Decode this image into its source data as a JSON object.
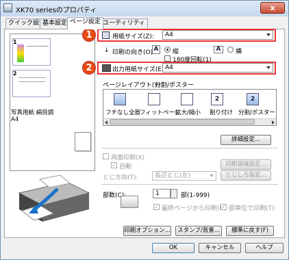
{
  "window": {
    "title": "XK70 seriesのプロパティ",
    "close_label": "x"
  },
  "tabs": [
    {
      "label": "クイック設定"
    },
    {
      "label": "基本設定"
    },
    {
      "label": "ページ設定"
    },
    {
      "label": "ユーティリティ"
    }
  ],
  "badges": {
    "one": "1",
    "two": "2"
  },
  "left": {
    "media_label": "写真用紙 絹目調",
    "media_size": "A4"
  },
  "paper_size": {
    "label": "用紙サイズ(Z):",
    "value": "A4"
  },
  "orientation": {
    "label": "印刷の向き(O):",
    "portrait_label": "縦",
    "landscape_label": "横",
    "rotate_label": "180度回転(1)",
    "portrait_icon": "A",
    "landscape_icon": "A"
  },
  "output_size": {
    "label": "出力用紙サイズ(E):",
    "value": "A4"
  },
  "page_layout": {
    "label": "ページレイアウト(Y):",
    "value": "分割/ポスター",
    "options": [
      "フチなし全面",
      "フィットページ",
      "拡大/縮小",
      "割り付け",
      "分割/ポスター"
    ],
    "icon_numbers": [
      "",
      "",
      "",
      "2",
      "2"
    ]
  },
  "buttons": {
    "detail": "詳細設定...",
    "stamp_detail": "印刷領域設定...",
    "binding": "とじしろ指定...",
    "print_options": "印刷オプション...",
    "stamp": "スタンプ/背景...",
    "defaults": "標準に戻す(F)",
    "ok": "OK",
    "cancel": "キャンセル",
    "help": "ヘルプ"
  },
  "duplex": {
    "label": "両面印刷(X)",
    "auto_label": "自動"
  },
  "binding_side": {
    "label": "とじ方向(T):",
    "value": "長辺とじ(左)"
  },
  "copies": {
    "label": "部数(C):",
    "value": "1",
    "unit": "部(1-999)",
    "reverse_label": "最終ページから印刷(R)",
    "collate_label": "部単位で印刷(T)"
  },
  "preview_page_numbers": [
    "1",
    "2"
  ]
}
